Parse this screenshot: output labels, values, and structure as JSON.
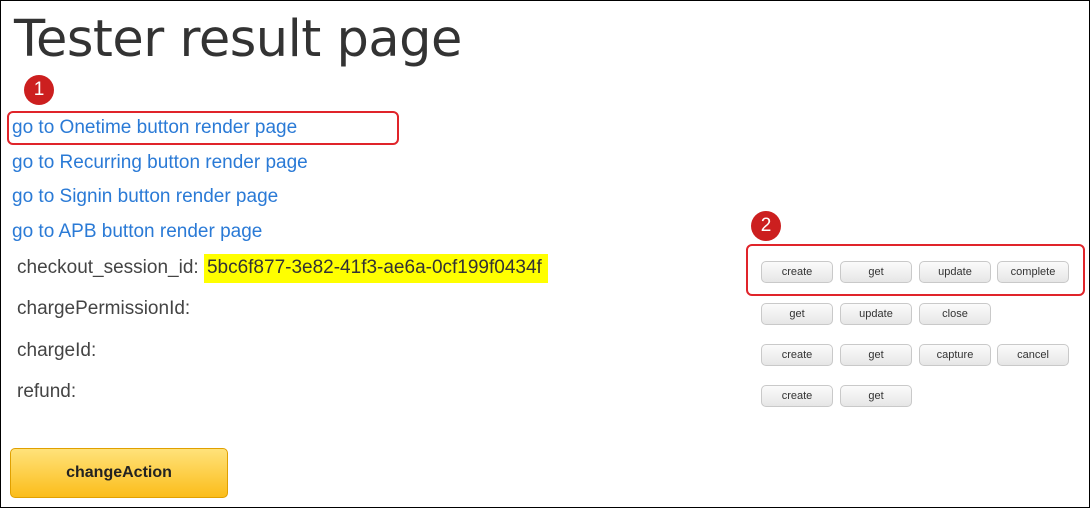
{
  "page": {
    "title": "Tester result page"
  },
  "links": [
    "go to Onetime button render page",
    "go to Recurring button render page",
    "go to Signin button render page",
    "go to APB button render page"
  ],
  "rows": {
    "checkout_session": {
      "label": "checkout_session_id:",
      "value": "5bc6f877-3e82-41f3-ae6a-0cf199f0434f",
      "buttons": [
        "create",
        "get",
        "update",
        "complete"
      ]
    },
    "charge_permission": {
      "label": "chargePermissionId:",
      "buttons": [
        "get",
        "update",
        "close"
      ]
    },
    "charge": {
      "label": "chargeId:",
      "buttons": [
        "create",
        "get",
        "capture",
        "cancel"
      ]
    },
    "refund": {
      "label": "refund:",
      "buttons": [
        "create",
        "get"
      ]
    }
  },
  "action_button": {
    "label": "changeAction"
  },
  "annotations": {
    "badge_1": "1",
    "badge_2": "2",
    "color": "#e0242a"
  }
}
